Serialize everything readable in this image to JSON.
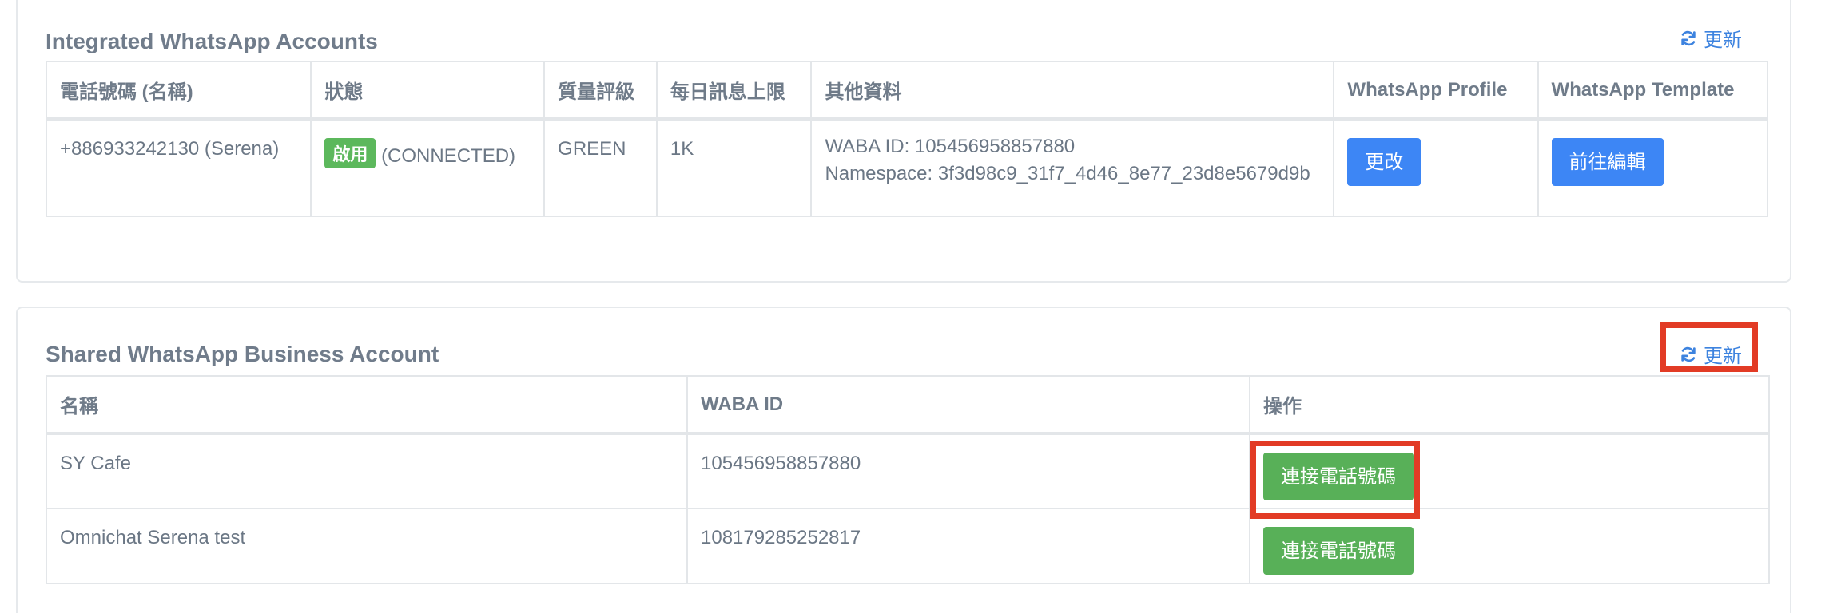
{
  "integrated": {
    "title": "Integrated WhatsApp Accounts",
    "refresh_label": "更新",
    "columns": [
      "電話號碼 (名稱)",
      "狀態",
      "質量評級",
      "每日訊息上限",
      "其他資料",
      "WhatsApp Profile",
      "WhatsApp Template"
    ],
    "rows": [
      {
        "phone": "+886933242130 (Serena)",
        "status_badge": "啟用",
        "status_text": "(CONNECTED)",
        "quality": "GREEN",
        "limit": "1K",
        "waba_id": "WABA ID: 105456958857880",
        "namespace": "Namespace: 3f3d98c9_31f7_4d46_8e77_23d8e5679d9b",
        "profile_button": "更改",
        "template_button": "前往編輯"
      }
    ]
  },
  "shared": {
    "title": "Shared WhatsApp Business Account",
    "refresh_label": "更新",
    "columns": [
      "名稱",
      "WABA ID",
      "操作"
    ],
    "rows": [
      {
        "name": "SY Cafe",
        "waba_id": "105456958857880",
        "action": "連接電話號碼"
      },
      {
        "name": "Omnichat Serena test",
        "waba_id": "108179285252817",
        "action": "連接電話號碼"
      }
    ]
  },
  "colors": {
    "accent_blue": "#3d86f5",
    "success_green": "#58b058",
    "highlight_red": "#e23b25"
  }
}
